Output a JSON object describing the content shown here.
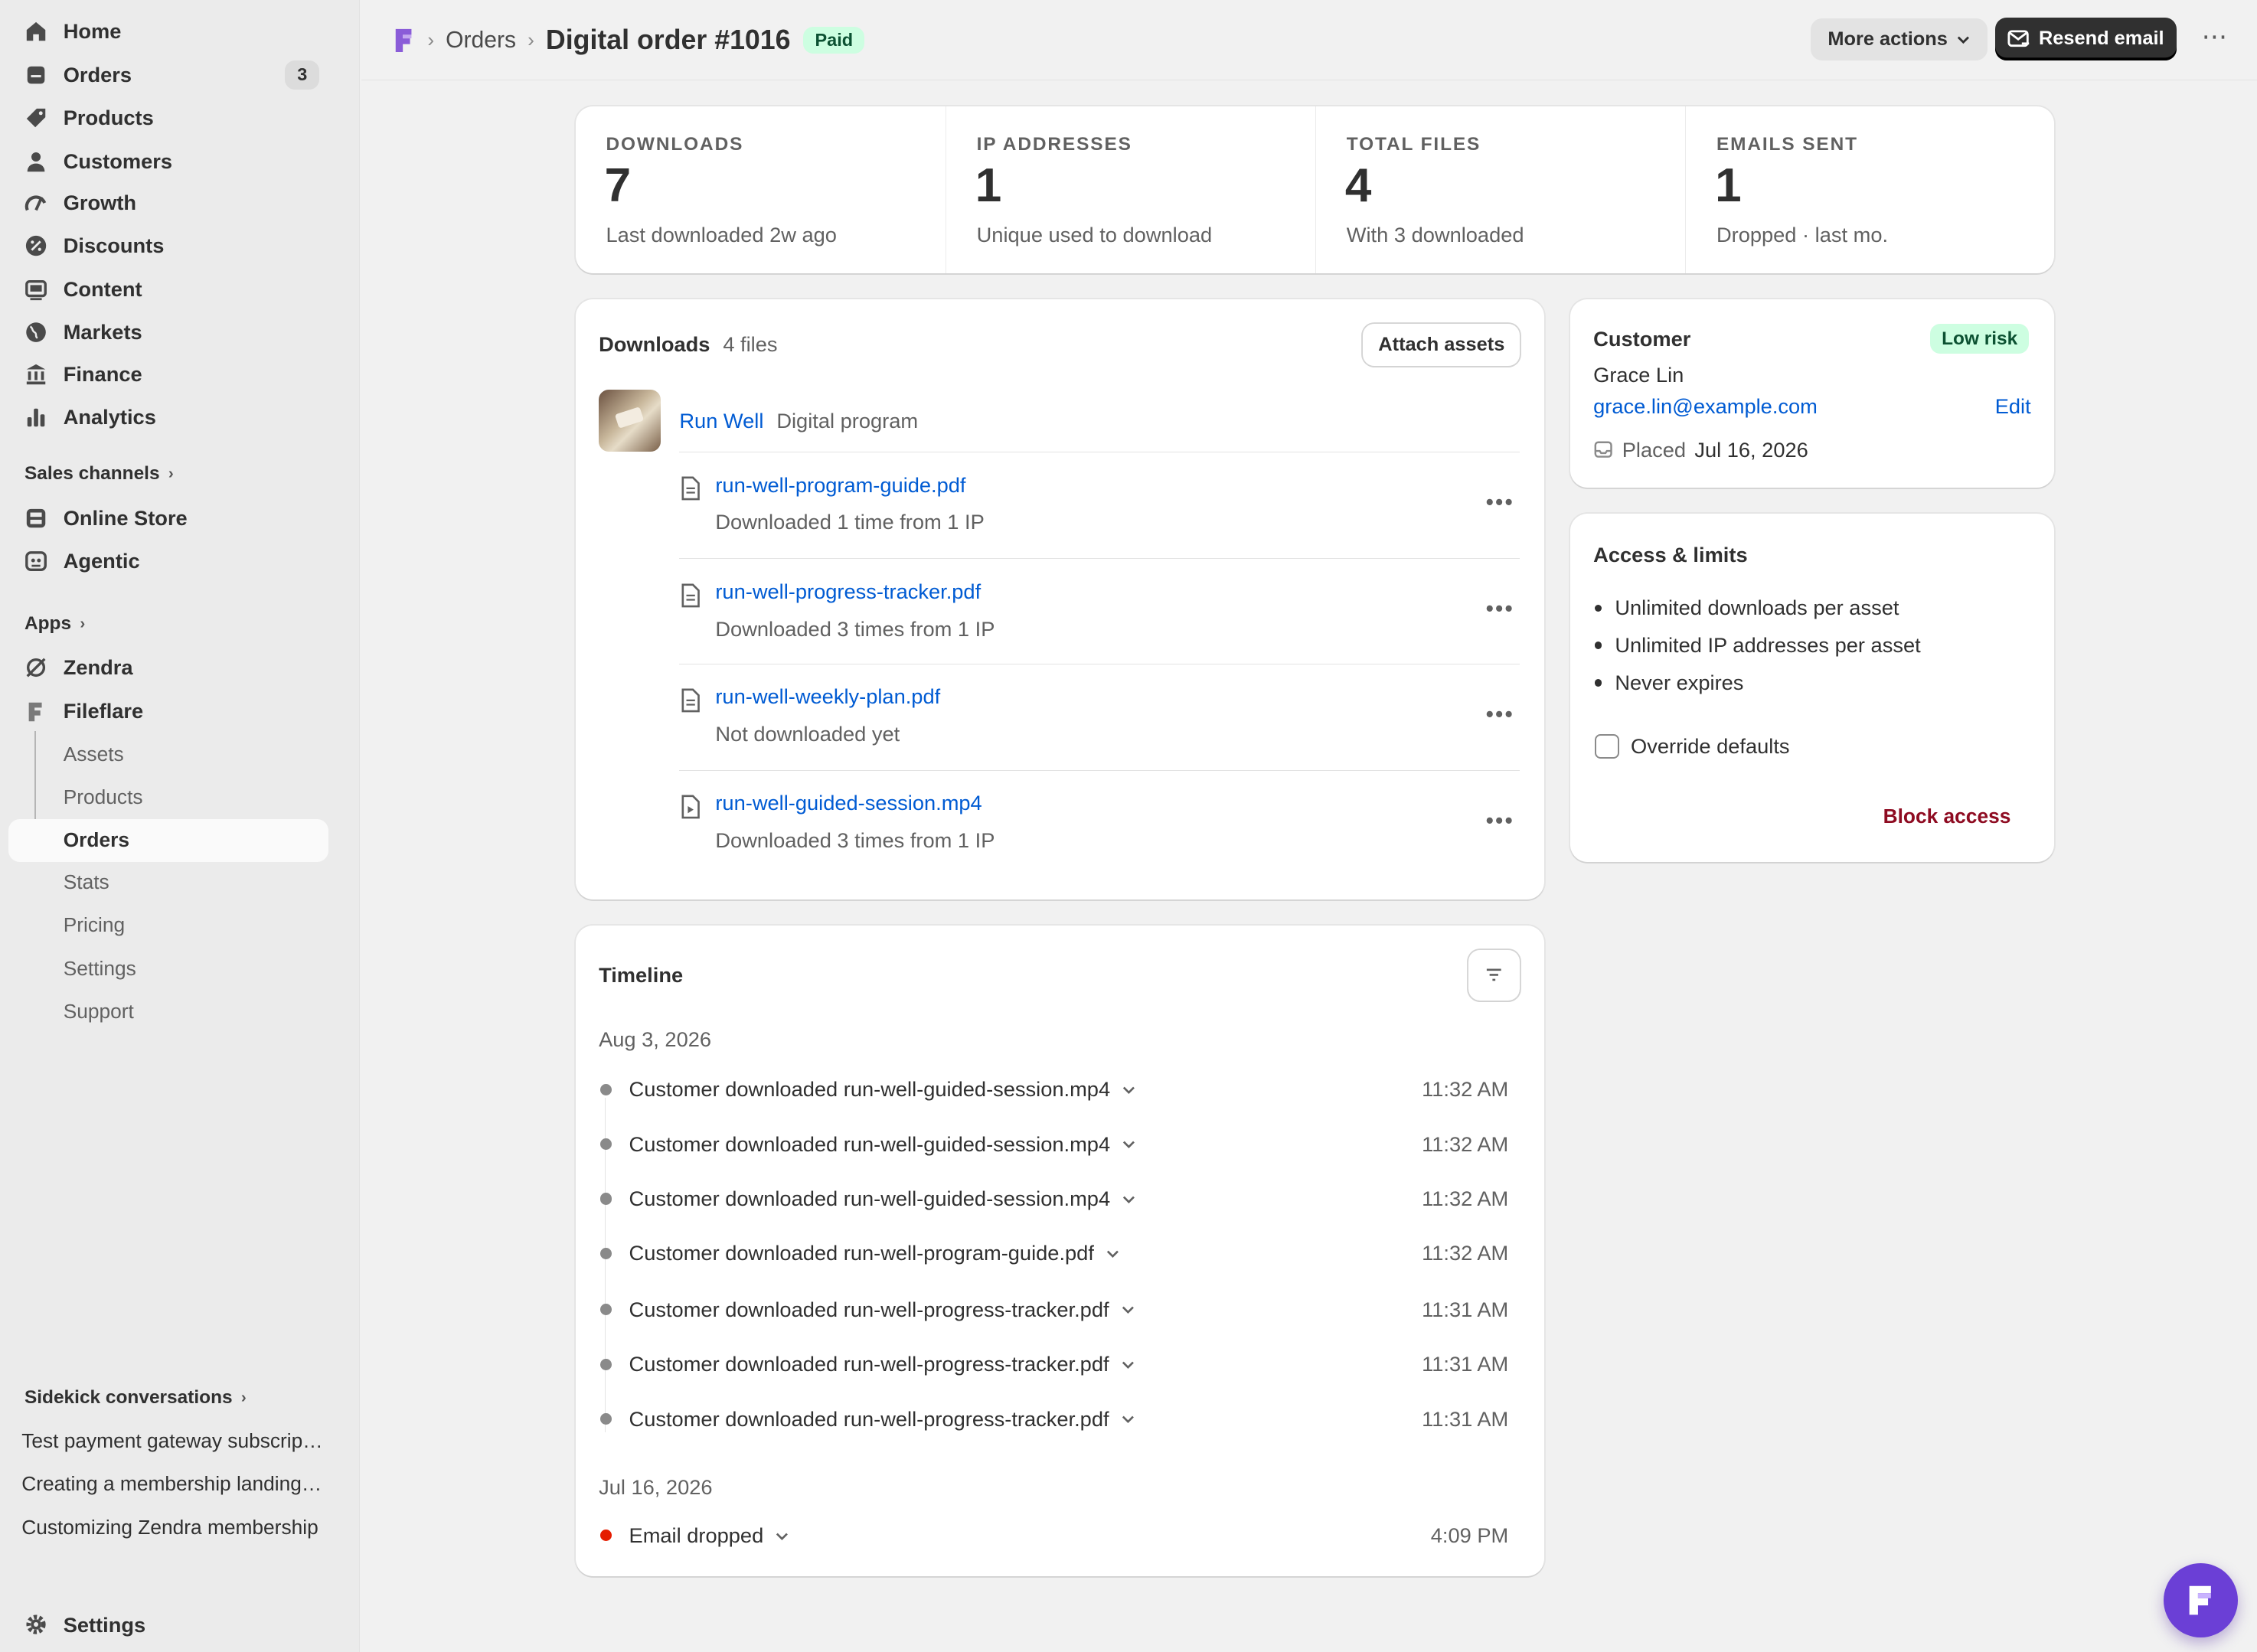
{
  "sidebar": {
    "nav": [
      {
        "label": "Home",
        "icon": "home-icon"
      },
      {
        "label": "Orders",
        "icon": "orders-icon",
        "badge": "3"
      },
      {
        "label": "Products",
        "icon": "tag-icon"
      },
      {
        "label": "Customers",
        "icon": "person-icon"
      },
      {
        "label": "Growth",
        "icon": "growth-icon"
      },
      {
        "label": "Discounts",
        "icon": "discount-icon"
      },
      {
        "label": "Content",
        "icon": "content-icon"
      },
      {
        "label": "Markets",
        "icon": "globe-icon"
      },
      {
        "label": "Finance",
        "icon": "bank-icon"
      },
      {
        "label": "Analytics",
        "icon": "bar-chart-icon"
      }
    ],
    "sales_channels_label": "Sales channels",
    "channels": [
      {
        "label": "Online Store",
        "icon": "store-icon"
      },
      {
        "label": "Agentic",
        "icon": "agentic-icon"
      }
    ],
    "apps_label": "Apps",
    "apps": [
      {
        "label": "Zendra",
        "icon": "zendra-icon"
      },
      {
        "label": "Fileflare",
        "icon": "fileflare-icon"
      }
    ],
    "fileflare_sub": [
      "Assets",
      "Products",
      "Orders",
      "Stats",
      "Pricing",
      "Settings",
      "Support"
    ],
    "sidekick_label": "Sidekick conversations",
    "sidekick": [
      "Test payment gateway subscription",
      "Creating a membership landing page",
      "Customizing Zendra membership"
    ],
    "settings_label": "Settings"
  },
  "header": {
    "breadcrumb_parent": "Orders",
    "title": "Digital order #1016",
    "status": "Paid",
    "more_actions": "More actions",
    "resend_email": "Resend email"
  },
  "stats": [
    {
      "label": "DOWNLOADS",
      "value": "7",
      "sub": "Last downloaded 2w ago"
    },
    {
      "label": "IP ADDRESSES",
      "value": "1",
      "sub": "Unique used to download"
    },
    {
      "label": "TOTAL FILES",
      "value": "4",
      "sub": "With 3 downloaded"
    },
    {
      "label": "EMAILS SENT",
      "value": "1",
      "sub": "Dropped · last mo."
    }
  ],
  "downloads": {
    "title": "Downloads",
    "count": "4 files",
    "attach": "Attach assets",
    "product_name": "Run Well",
    "product_type": "Digital program",
    "files": [
      {
        "name": "run-well-program-guide.pdf",
        "sub": "Downloaded 1 time from 1 IP",
        "icon": "document-icon"
      },
      {
        "name": "run-well-progress-tracker.pdf",
        "sub": "Downloaded 3 times from 1 IP",
        "icon": "document-icon"
      },
      {
        "name": "run-well-weekly-plan.pdf",
        "sub": "Not downloaded yet",
        "icon": "document-icon"
      },
      {
        "name": "run-well-guided-session.mp4",
        "sub": "Downloaded 3 times from 1 IP",
        "icon": "video-file-icon"
      }
    ]
  },
  "timeline": {
    "title": "Timeline",
    "groups": [
      {
        "date": "Aug 3, 2026",
        "events": [
          {
            "text": "Customer downloaded run-well-guided-session.mp4",
            "time": "11:32 AM"
          },
          {
            "text": "Customer downloaded run-well-guided-session.mp4",
            "time": "11:32 AM"
          },
          {
            "text": "Customer downloaded run-well-guided-session.mp4",
            "time": "11:32 AM"
          },
          {
            "text": "Customer downloaded run-well-program-guide.pdf",
            "time": "11:32 AM"
          },
          {
            "text": "Customer downloaded run-well-progress-tracker.pdf",
            "time": "11:31 AM"
          },
          {
            "text": "Customer downloaded run-well-progress-tracker.pdf",
            "time": "11:31 AM"
          },
          {
            "text": "Customer downloaded run-well-progress-tracker.pdf",
            "time": "11:31 AM"
          }
        ]
      },
      {
        "date": "Jul 16, 2026",
        "events": [
          {
            "text": "Email dropped",
            "time": "4:09 PM",
            "status_color": "#e51c00"
          }
        ]
      }
    ]
  },
  "customer": {
    "title": "Customer",
    "risk": "Low risk",
    "name": "Grace Lin",
    "email": "grace.lin@example.com",
    "edit": "Edit",
    "placed_label": "Placed",
    "placed_date": "Jul 16, 2026"
  },
  "access": {
    "title": "Access & limits",
    "items": [
      "Unlimited downloads per asset",
      "Unlimited IP addresses per asset",
      "Never expires"
    ],
    "override": "Override defaults",
    "block": "Block access"
  },
  "colors": {
    "accent": "#005bd3",
    "success_bg": "#cdfee1",
    "danger": "#8e0b21",
    "fab": "#6b3fd6"
  }
}
